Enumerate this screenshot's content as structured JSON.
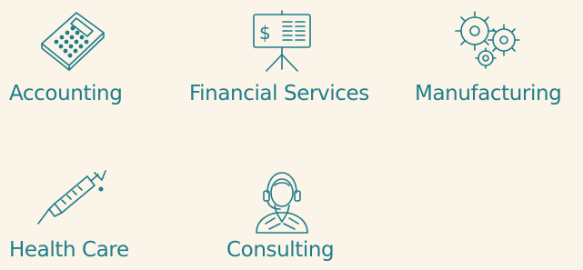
{
  "industries": [
    {
      "label": "Accounting",
      "icon": "calculator-icon"
    },
    {
      "label": "Financial Services",
      "icon": "presentation-board-icon"
    },
    {
      "label": "Manufacturing",
      "icon": "gears-icon"
    },
    {
      "label": "Health Care",
      "icon": "syringe-icon"
    },
    {
      "label": "Consulting",
      "icon": "headset-agent-icon"
    }
  ],
  "colors": {
    "background": "#fbf4e8",
    "accent": "#1f7d8a"
  }
}
